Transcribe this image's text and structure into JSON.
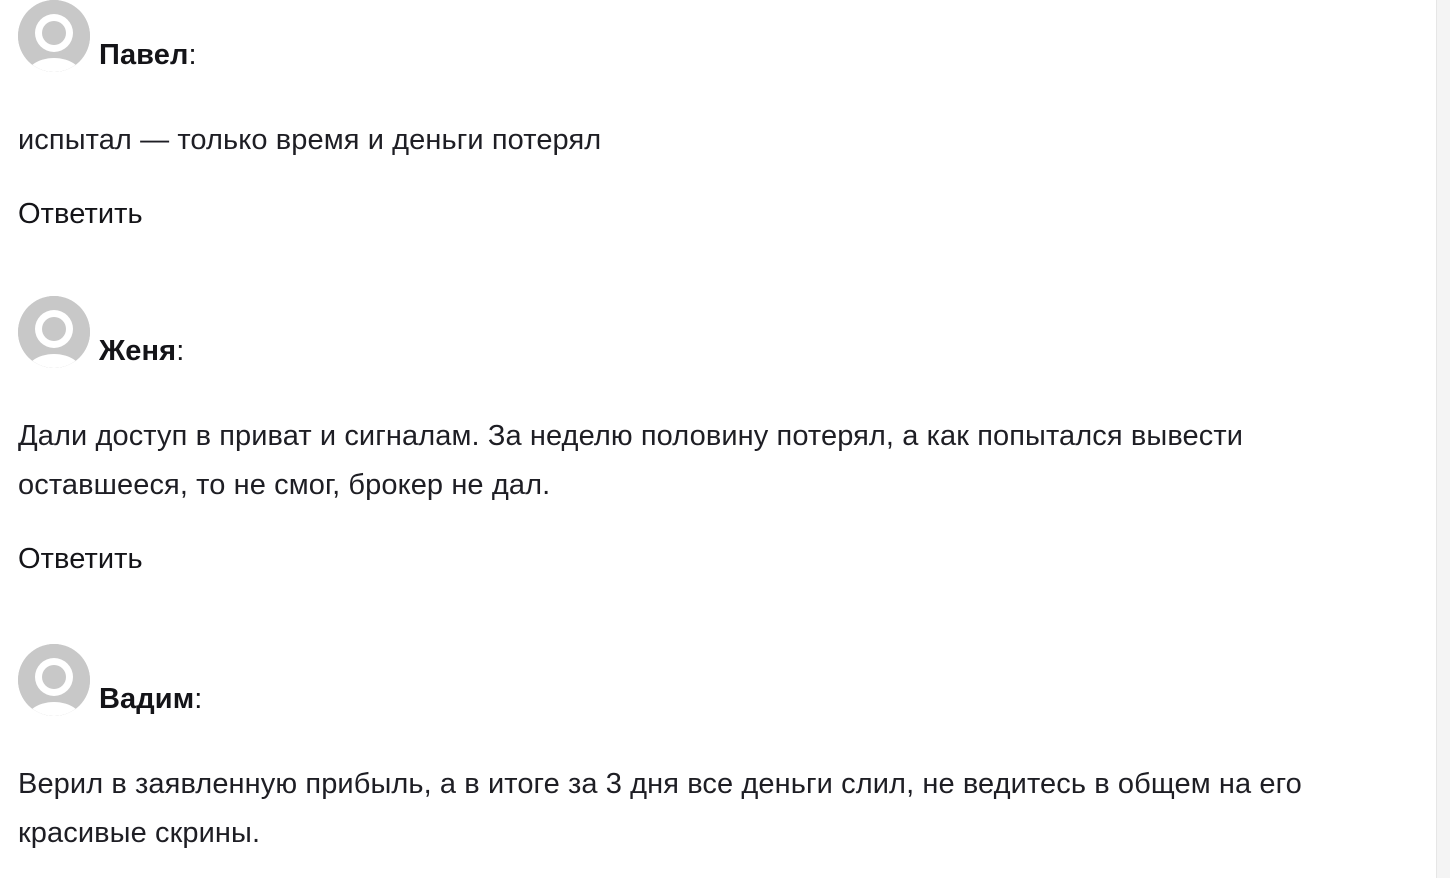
{
  "comments": [
    {
      "author": "Павел",
      "text": "испытал — только время и деньги потерял",
      "reply_label": "Ответить"
    },
    {
      "author": "Женя",
      "text": "Дали доступ в приват и сигналам. За неделю половину потерял, а как попытался вывести оставшееся, то не смог, брокер не дал.",
      "reply_label": "Ответить"
    },
    {
      "author": "Вадим",
      "text": "Верил в заявленную прибыль, а в итоге за 3 дня все деньги слил, не ведитесь в общем на его красивые скрины.",
      "reply_label": ""
    }
  ],
  "author_separator": ":",
  "avatar_icon": "default-user-avatar-icon",
  "colors": {
    "avatar_bg": "#c8c8c8",
    "avatar_fg": "#ffffff",
    "text": "#1e1e24"
  }
}
